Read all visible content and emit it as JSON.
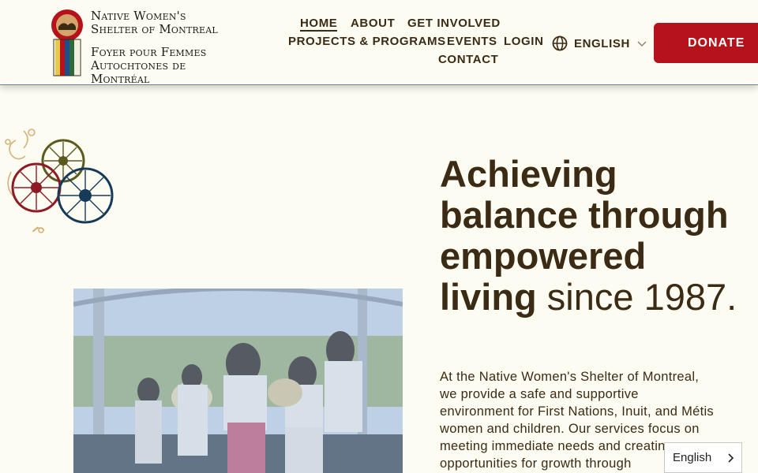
{
  "header": {
    "logo": {
      "line1": "Native Women's",
      "line2": "Shelter of Montreal",
      "line3": "Foyer pour Femmes",
      "line4": "Autochtones de Montréal"
    },
    "nav": {
      "home": "Home",
      "about": "About",
      "get_involved": "Get Involved",
      "projects": "Projects & Programs",
      "events": "Events",
      "login": "Login",
      "contact": "Contact"
    },
    "language": "English",
    "donate": "Donate"
  },
  "hero": {
    "headline_bold": "Achieving balance through empowered living",
    "headline_light": "since 1987.",
    "intro": "At the Native Women's Shelter of Montreal, we provide a safe and supportive environment for First Nations, Inuit, and Métis women and children. Our services focus on meeting immediate needs and creating opportunities for growth through"
  },
  "language_widget": {
    "label": "English"
  },
  "colors": {
    "background": "#fdfcf2",
    "text": "#3b2a14",
    "donate": "#b5121b"
  }
}
